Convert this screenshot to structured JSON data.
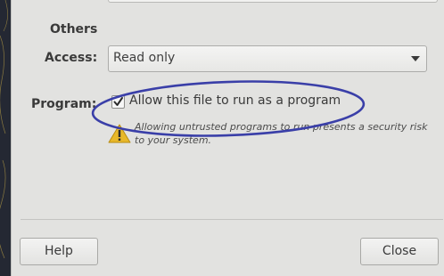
{
  "others": {
    "section_title": "Others",
    "access_label": "Access:",
    "access_value": "Read only"
  },
  "program": {
    "label": "Program:",
    "checkbox_label": "Allow this file to run as a program",
    "checked": true,
    "warning_text": "Allowing untrusted programs to run presents a security risk to your system."
  },
  "buttons": {
    "help": "Help",
    "close": "Close"
  },
  "annotation": {
    "color": "#3a3fa8",
    "shape": "ellipse"
  },
  "colors": {
    "dialog_bg": "#e2e2e0",
    "warning_icon": "#e8b82a"
  }
}
